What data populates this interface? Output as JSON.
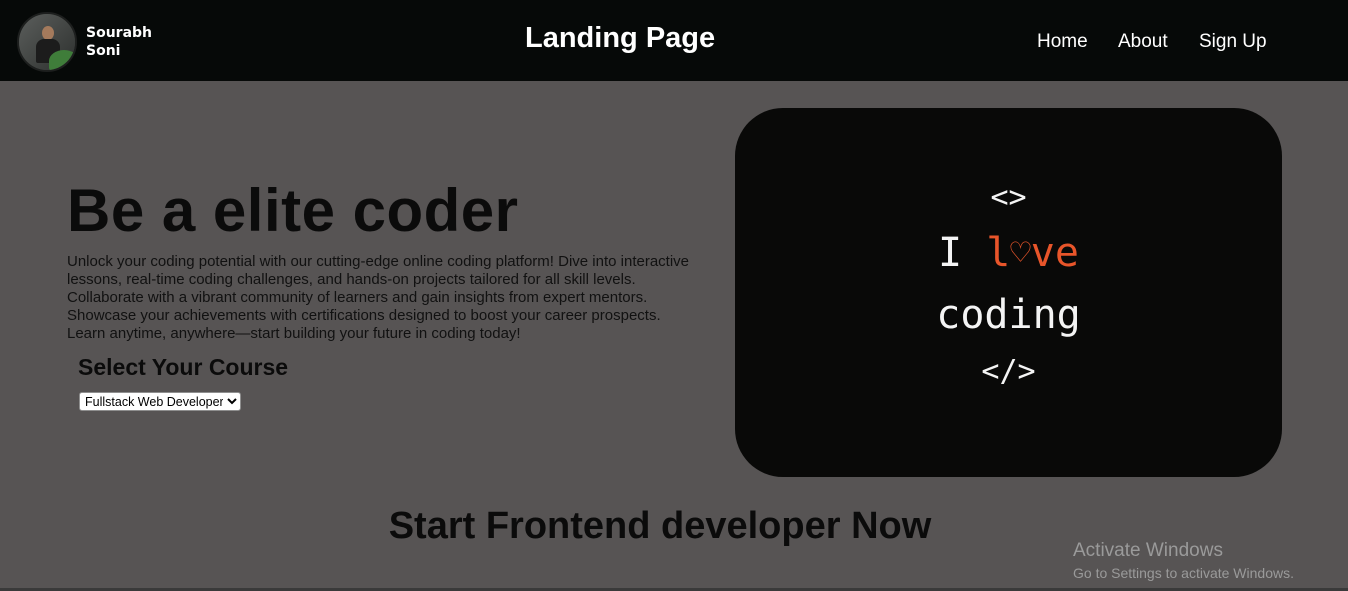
{
  "header": {
    "user_name": "Sourabh Soni",
    "title": "Landing Page",
    "nav": [
      {
        "label": "Home"
      },
      {
        "label": "About"
      },
      {
        "label": "Sign Up"
      }
    ]
  },
  "hero": {
    "title": "Be a elite coder",
    "description": "Unlock your coding potential with our cutting-edge online coding platform! Dive into interactive lessons, real-time coding challenges, and hands-on projects tailored for all skill levels. Collaborate with a vibrant community of learners and gain insights from expert mentors. Showcase your achievements with certifications designed to boost your career prospects. Learn anytime, anywhere—start building your future in coding today!",
    "course_heading": "Select Your Course",
    "course_selected": "Fullstack Web Developer"
  },
  "code_card": {
    "line1": "<>",
    "line2_prefix": "I ",
    "line2_l": "l",
    "line2_heart": "♡",
    "line2_rest": "ve",
    "line3": "coding",
    "line4": "</>"
  },
  "section": {
    "title": "Start Frontend developer Now"
  },
  "watermark": {
    "title": "Activate Windows",
    "subtitle": "Go to Settings to activate Windows."
  },
  "colors": {
    "background": "#575454",
    "navbar": "#060908",
    "accent": "#e8552a"
  }
}
